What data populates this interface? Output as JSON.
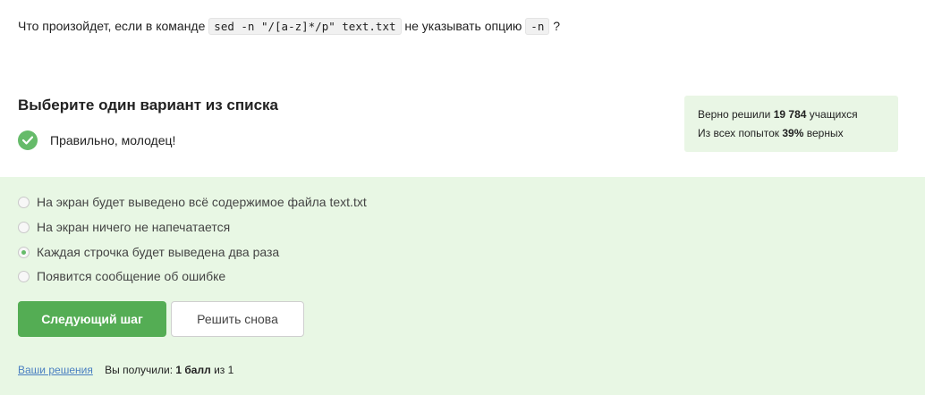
{
  "question": {
    "prefix": "Что произойдет, если в команде",
    "command": "sed -n \"/[a-z]*/p\" text.txt",
    "middle": "не указывать опцию",
    "option": "-n",
    "suffix": "?"
  },
  "task": {
    "title": "Выберите один вариант из списка",
    "result_message": "Правильно, молодец!",
    "result_icon": "check-circle-icon"
  },
  "stats": {
    "solved_prefix": "Верно решили",
    "solved_count": "19 784",
    "solved_suffix": "учащихся",
    "attempts_prefix": "Из всех попыток",
    "attempts_percent": "39%",
    "attempts_suffix": "верных"
  },
  "options": [
    {
      "label": "На экран будет выведено всё содержимое файла text.txt",
      "selected": false
    },
    {
      "label": "На экран ничего не напечатается",
      "selected": false
    },
    {
      "label": "Каждая строчка будет выведена два раза",
      "selected": true
    },
    {
      "label": "Появится сообщение об ошибке",
      "selected": false
    }
  ],
  "buttons": {
    "next": "Следующий шаг",
    "retry": "Решить снова"
  },
  "footer": {
    "solutions_link": "Ваши решения",
    "score_prefix": "Вы получили:",
    "score_value": "1 балл",
    "score_suffix": "из 1"
  },
  "colors": {
    "accent_green": "#54ad54",
    "answers_bg": "#e8f7e4",
    "stats_bg": "#e9f6e5",
    "link": "#4a7fc1"
  }
}
